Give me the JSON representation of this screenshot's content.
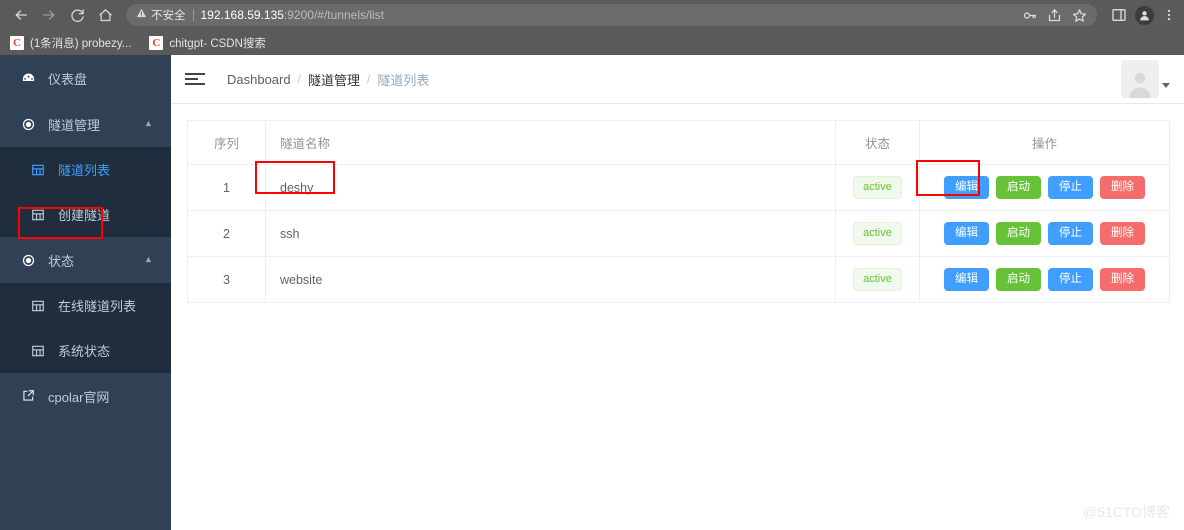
{
  "browser": {
    "nav": {
      "back": "back-arrow",
      "forward": "forward-arrow",
      "reload": "reload",
      "home": "home"
    },
    "omnibox": {
      "security_icon": "warning-triangle",
      "security_label": "不安全",
      "url_host": "192.168.59.135",
      "url_path": ":9200/#/tunnels/list"
    },
    "actions": {
      "password_key": "key-icon",
      "share": "share-icon",
      "bookmark_star": "star-icon",
      "side_panel": "side-panel-icon",
      "profile": "profile-avatar-icon",
      "menu": "kebab-menu-icon"
    },
    "bookmarks": [
      {
        "favicon": "C",
        "label": "(1条消息) probezy..."
      },
      {
        "favicon": "C",
        "label": "chitgpt- CSDN搜索"
      }
    ]
  },
  "sidebar": {
    "items": [
      {
        "label": "仪表盘",
        "icon": "dashboard-icon",
        "type": "item",
        "active": false
      },
      {
        "label": "隧道管理",
        "icon": "tunnel-icon",
        "type": "group",
        "expanded": true
      },
      {
        "label": "隧道列表",
        "icon": "table-icon",
        "type": "sub",
        "active": true
      },
      {
        "label": "创建隧道",
        "icon": "table-icon",
        "type": "sub",
        "active": false
      },
      {
        "label": "状态",
        "icon": "status-icon",
        "type": "group",
        "expanded": true
      },
      {
        "label": "在线隧道列表",
        "icon": "table-icon",
        "type": "sub",
        "active": false
      },
      {
        "label": "系统状态",
        "icon": "table-icon",
        "type": "sub",
        "active": false
      },
      {
        "label": "cpolar官网",
        "icon": "external-link-icon",
        "type": "item",
        "active": false
      }
    ]
  },
  "navbar": {
    "hamburger": "menu-fold-icon",
    "breadcrumb": [
      {
        "label": "Dashboard",
        "current": false
      },
      {
        "label": "隧道管理",
        "current": false
      },
      {
        "label": "隧道列表",
        "current": true
      }
    ],
    "separator": "/",
    "avatar": "user-avatar"
  },
  "table": {
    "headers": {
      "index": "序列",
      "name": "隧道名称",
      "status": "状态",
      "operations": "操作"
    },
    "rows": [
      {
        "index": "1",
        "name": "deshy",
        "status": "active",
        "ops": [
          {
            "label": "编辑",
            "style": "primary"
          },
          {
            "label": "启动",
            "style": "success"
          },
          {
            "label": "停止",
            "style": "primary"
          },
          {
            "label": "删除",
            "style": "danger"
          }
        ]
      },
      {
        "index": "2",
        "name": "ssh",
        "status": "active",
        "ops": [
          {
            "label": "编辑",
            "style": "primary"
          },
          {
            "label": "启动",
            "style": "success"
          },
          {
            "label": "停止",
            "style": "primary"
          },
          {
            "label": "删除",
            "style": "danger"
          }
        ]
      },
      {
        "index": "3",
        "name": "website",
        "status": "active",
        "ops": [
          {
            "label": "编辑",
            "style": "primary"
          },
          {
            "label": "启动",
            "style": "success"
          },
          {
            "label": "停止",
            "style": "primary"
          },
          {
            "label": "删除",
            "style": "danger"
          }
        ]
      }
    ]
  },
  "annotations": {
    "highlight_color": "#ff0000",
    "boxes": [
      "sidebar-item-tunnel-list",
      "row-1-name-cell",
      "row-1-edit-button"
    ]
  },
  "watermark": "@51CTO博客",
  "colors": {
    "sidebar_bg": "#304156",
    "submenu_bg": "#1f2d3d",
    "accent": "#409eff",
    "success": "#67c23a",
    "danger": "#f56c6c",
    "status_text": "#67c23a",
    "status_bg": "#f0f9eb"
  }
}
